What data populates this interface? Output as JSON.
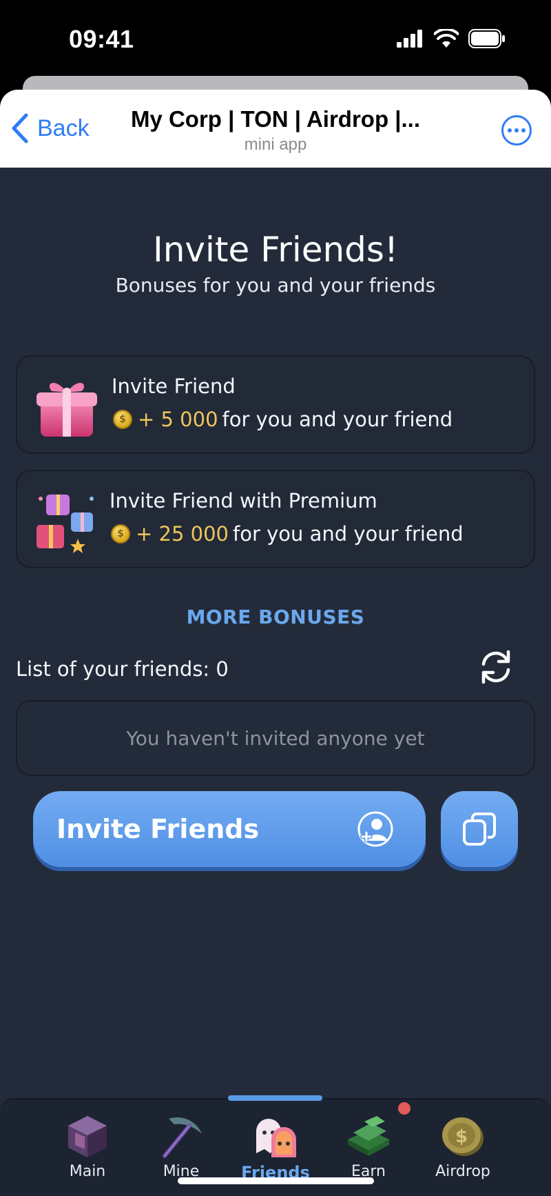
{
  "status_bar": {
    "time": "09:41"
  },
  "header": {
    "back_label": "Back",
    "title": "My Corp | TON | Airdrop |...",
    "subtitle": "mini app"
  },
  "page": {
    "title": "Invite Friends!",
    "subtitle": "Bonuses for you and your friends"
  },
  "cards": [
    {
      "title": "Invite Friend",
      "amount": "+ 5 000",
      "reward_text": "for you and your friend",
      "icon": "gift-box-icon"
    },
    {
      "title": "Invite Friend with Premium",
      "amount": "+ 25 000",
      "reward_text": "for you and your friend",
      "icon": "gift-stack-icon"
    }
  ],
  "more_bonuses": "MORE BONUSES",
  "friends": {
    "label": "List of your friends: 0",
    "empty_text": "You haven't invited anyone yet"
  },
  "actions": {
    "invite_label": "Invite Friends"
  },
  "tabs": [
    {
      "label": "Main",
      "icon": "crystal-cube-icon",
      "active": false
    },
    {
      "label": "Mine",
      "icon": "pickaxe-icon",
      "active": false
    },
    {
      "label": "Friends",
      "icon": "ghosts-icon",
      "active": true
    },
    {
      "label": "Earn",
      "icon": "money-stack-icon",
      "active": false
    },
    {
      "label": "Airdrop",
      "icon": "coin-icon",
      "active": false
    }
  ],
  "colors": {
    "background": "#232b3a",
    "accent": "#6aa8ee",
    "button": "#5b9be8",
    "reward": "#efc55a"
  }
}
